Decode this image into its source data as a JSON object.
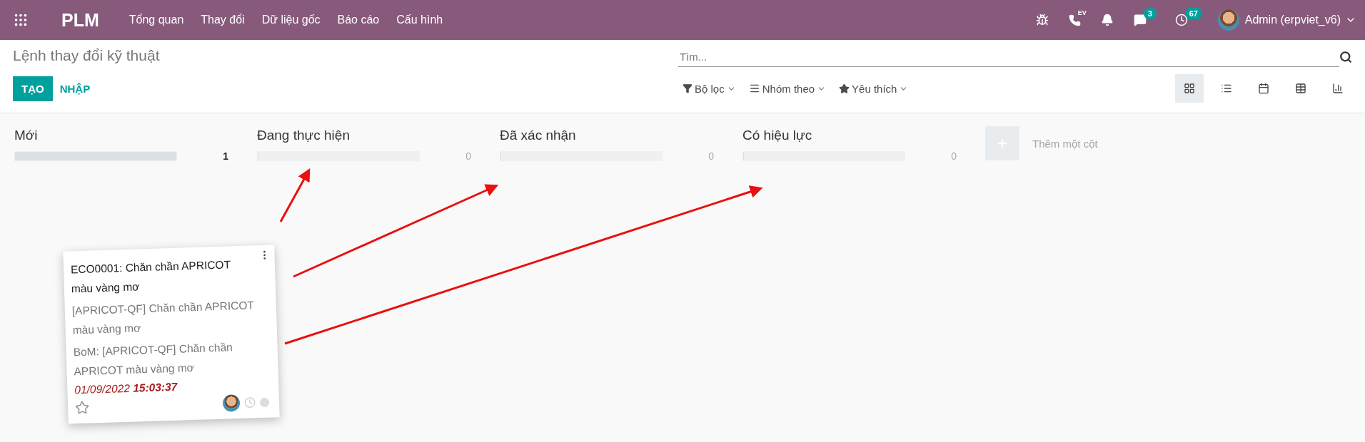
{
  "navbar": {
    "app_name": "PLM",
    "menu": [
      "Tổng quan",
      "Thay đổi",
      "Dữ liệu gốc",
      "Báo cáo",
      "Cấu hình"
    ],
    "phone_label": "EV",
    "messages_count": "3",
    "activities_count": "67",
    "user": "Admin (erpviet_v6)"
  },
  "control_panel": {
    "title": "Lệnh thay đổi kỹ thuật",
    "buttons": [
      {
        "label": "TẠO",
        "kind": "primary"
      },
      {
        "label": "NHẬP",
        "kind": "link"
      }
    ],
    "search": {
      "placeholder": "Tìm..."
    },
    "filters": [
      {
        "label": "Bộ lọc",
        "kind": "filter"
      },
      {
        "label": "Nhóm theo",
        "kind": "group"
      },
      {
        "label": "Yêu thích",
        "kind": "favorite"
      }
    ],
    "views": [
      {
        "kind": "kanban",
        "selected": true
      },
      {
        "kind": "list",
        "selected": false
      },
      {
        "kind": "calendar",
        "selected": false
      },
      {
        "kind": "pivot",
        "selected": false
      },
      {
        "kind": "graph",
        "selected": false
      }
    ]
  },
  "columns": [
    {
      "title": "Mới",
      "count": "1",
      "level": 1
    },
    {
      "title": "Đang thực hiện",
      "count": "0",
      "level": 0
    },
    {
      "title": "Đã xác nhận",
      "count": "0",
      "level": 0
    },
    {
      "title": "Có hiệu lực",
      "count": "0",
      "level": 0
    }
  ],
  "add_column": {
    "label": "Thêm một cột"
  },
  "dragged_card": {
    "title": "ECO0001: Chăn chần APRICOT màu vàng mơ",
    "product": "[APRICOT-QF] Chăn chần APRICOT màu vàng mơ",
    "bom": "BoM: [APRICOT-QF] Chăn chần APRICOT màu vàng mơ",
    "deadline": "01/09/2022 **15:03:37**",
    "starred": false
  }
}
